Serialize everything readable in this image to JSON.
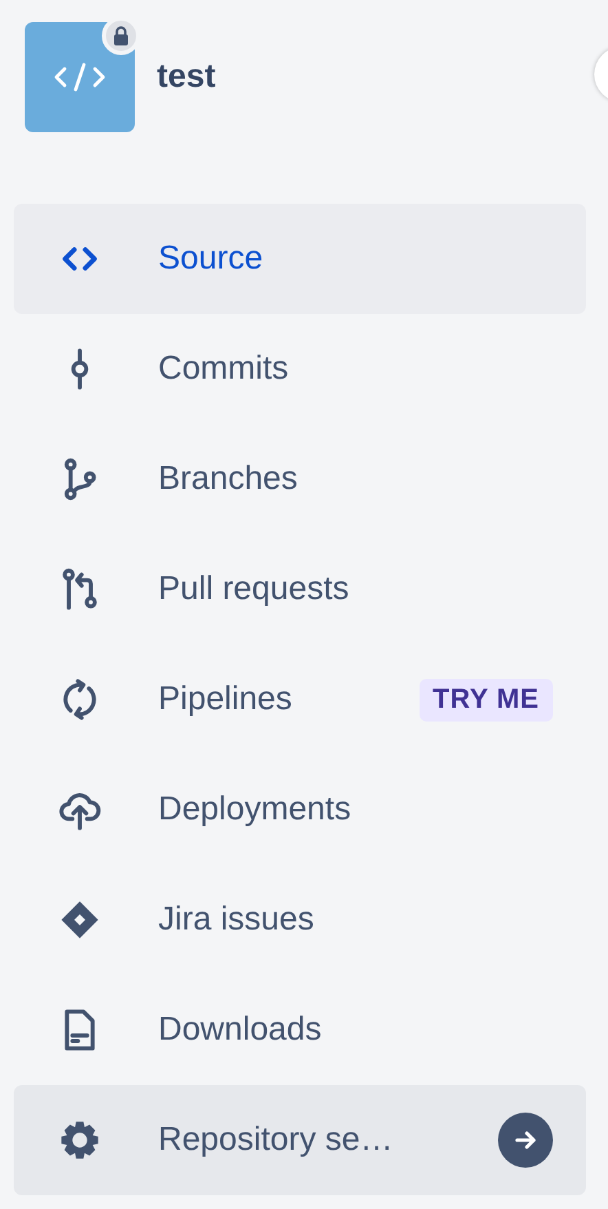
{
  "repository": {
    "name": "test",
    "private": true
  },
  "nav": [
    {
      "label": "Source",
      "selected": true,
      "hovered": false,
      "arrow": false
    },
    {
      "label": "Commits",
      "selected": false,
      "hovered": false,
      "arrow": false
    },
    {
      "label": "Branches",
      "selected": false,
      "hovered": false,
      "arrow": false
    },
    {
      "label": "Pull requests",
      "selected": false,
      "hovered": false,
      "arrow": false
    },
    {
      "label": "Pipelines",
      "badge": "TRY ME",
      "selected": false,
      "hovered": false,
      "arrow": false
    },
    {
      "label": "Deployments",
      "selected": false,
      "hovered": false,
      "arrow": false
    },
    {
      "label": "Jira issues",
      "selected": false,
      "hovered": false,
      "arrow": false
    },
    {
      "label": "Downloads",
      "selected": false,
      "hovered": false,
      "arrow": false
    },
    {
      "label": "Repository se…",
      "selected": false,
      "hovered": true,
      "arrow": true
    }
  ]
}
